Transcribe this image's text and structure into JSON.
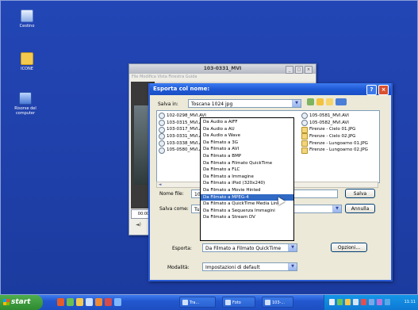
{
  "desktop": {
    "icons": [
      {
        "label": "Cestino",
        "icon": "recycle-bin-icon"
      },
      {
        "label": "ICONE",
        "icon": "folder-icon"
      },
      {
        "label": "Risorse del computer",
        "icon": "my-computer-icon"
      }
    ]
  },
  "player": {
    "title": "103-0331_MVI",
    "menu": "File  Modifica  Vista  Finestra  Guida",
    "time": "00:00"
  },
  "dialog": {
    "title": "Esporta col nome:",
    "save_in_label": "Salva in:",
    "save_in_value": "Toscana 1024 jpg",
    "files_left": [
      "102-0298_MVI.AVI",
      "103-0315_MVI.AVI",
      "103-0317_MVI.AVI",
      "103-0331_MVI.AVI",
      "103-0338_MVI.AVI",
      "105-0580_MVI.AVI"
    ],
    "files_right": [
      "105-0581_MVI.AVI",
      "105-0582_MVI.AVI",
      "Firenze - Cielo 01.JPG",
      "Firenze - Cielo 02.JPG",
      "Firenze - Lungoarno 01.JPG",
      "Firenze - Lungoarno 02.JPG"
    ],
    "filename_label": "Nome file:",
    "filename_value": "10",
    "saveas_label": "Salva come:",
    "saveas_value": "Tu",
    "save_button": "Salva",
    "cancel_button": "Annulla",
    "export_label": "Esporta:",
    "export_value": "Da Filmato a Filmato QuickTime",
    "options_button": "Opzioni...",
    "mode_label": "Modalità:",
    "mode_value": "Impostazioni di default"
  },
  "export_menu": {
    "selected_index": 11,
    "items": [
      "Da Audio a AIFF",
      "Da Audio a AU",
      "Da Audio a Wave",
      "Da Filmato a 3G",
      "Da Filmato a AVI",
      "Da Filmato a BMP",
      "Da Filmato a Filmato QuickTime",
      "Da Filmato a FLC",
      "Da Filmato a Immagine",
      "Da Filmato a iPod (320x240)",
      "Da Filmato a Movie Hinted",
      "Da Filmato a MPEG-4",
      "Da Filmato a QuickTime Media Link",
      "Da Filmato a Sequenza Immagini",
      "Da Filmato a Stream DV"
    ]
  },
  "taskbar": {
    "start_label": "start",
    "tasks": [
      "Tra...",
      "Foto",
      "103-..."
    ],
    "clock": "11:11"
  },
  "colors": {
    "desktop": "#1c3fa8",
    "titlebar": "#1f5ad6",
    "selection": "#316ac5",
    "taskbar": "#2257d0"
  }
}
